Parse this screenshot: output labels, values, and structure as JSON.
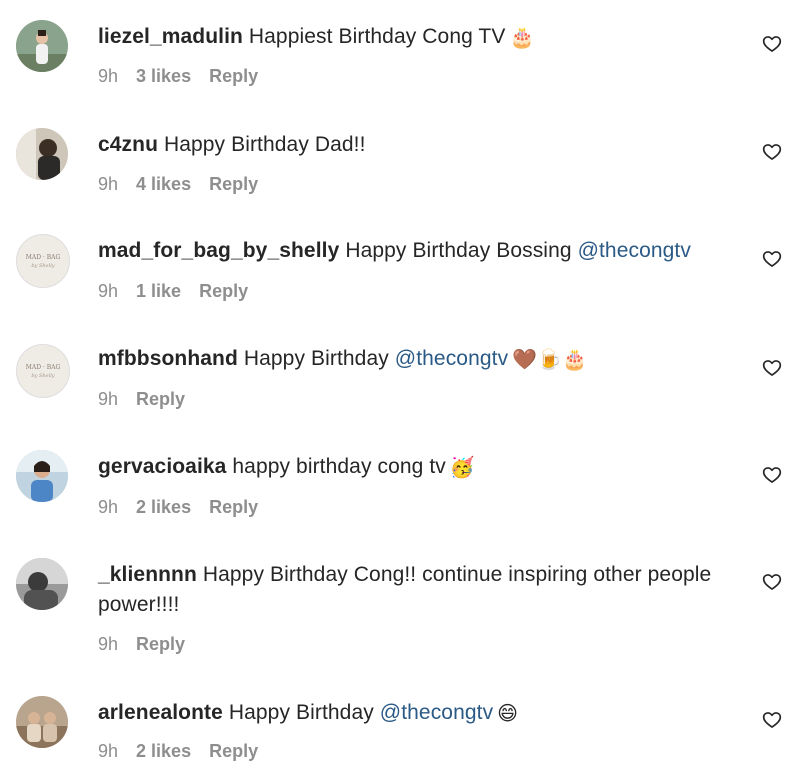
{
  "comments": [
    {
      "username": "liezel_madulin",
      "text": "Happiest Birthday Cong TV",
      "mention": "",
      "emojis": "🎂",
      "time": "9h",
      "likes": "3 likes",
      "reply": "Reply"
    },
    {
      "username": "c4znu",
      "text": "Happy Birthday Dad!!",
      "mention": "",
      "emojis": "",
      "time": "9h",
      "likes": "4 likes",
      "reply": "Reply"
    },
    {
      "username": "mad_for_bag_by_shelly",
      "text": "Happy Birthday Bossing",
      "mention": "@thecongtv",
      "emojis": "",
      "time": "9h",
      "likes": "1 like",
      "reply": "Reply",
      "avatar_text": "MAD BAG by Shelly"
    },
    {
      "username": "mfbbsonhand",
      "text": "Happy Birthday",
      "mention": "@thecongtv",
      "emojis": "🤎🍺🎂",
      "time": "9h",
      "likes": "",
      "reply": "Reply",
      "avatar_text": "MAD BAG by Shelly"
    },
    {
      "username": "gervacioaika",
      "text": "happy birthday cong tv",
      "mention": "",
      "emojis": "🥳",
      "time": "9h",
      "likes": "2 likes",
      "reply": "Reply"
    },
    {
      "username": "_kliennnn",
      "text": "Happy Birthday Cong!! continue inspiring other people power!!!!",
      "mention": "",
      "emojis": "",
      "time": "9h",
      "likes": "",
      "reply": "Reply"
    },
    {
      "username": "arlenealonte",
      "text": "Happy Birthday",
      "mention": "@thecongtv",
      "emojis": "😄",
      "time": "9h",
      "likes": "2 likes",
      "reply": "Reply"
    }
  ],
  "icons": {
    "like": "heart-outline-icon"
  },
  "colors": {
    "mention": "#2b5a86",
    "meta": "#8e8e8e",
    "text": "#262626"
  }
}
